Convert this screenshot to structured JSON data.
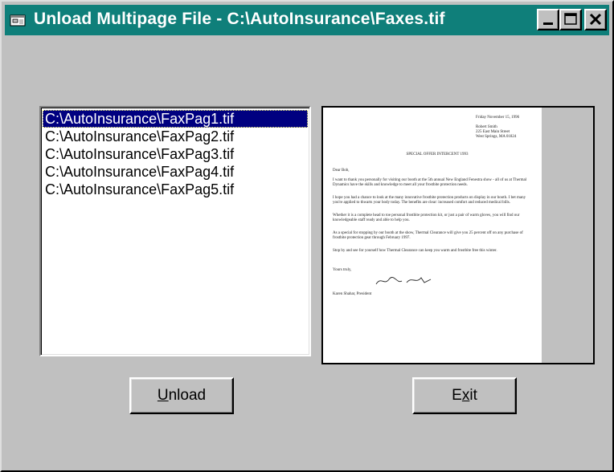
{
  "window": {
    "title": "Unload Multipage File - C:\\AutoInsurance\\Faxes.tif"
  },
  "list": {
    "items": [
      "C:\\AutoInsurance\\FaxPag1.tif",
      "C:\\AutoInsurance\\FaxPag2.tif",
      "C:\\AutoInsurance\\FaxPag3.tif",
      "C:\\AutoInsurance\\FaxPag4.tif",
      "C:\\AutoInsurance\\FaxPag5.tif"
    ],
    "selected_index": 0
  },
  "preview": {
    "date": "Friday November 15, 1996",
    "address": [
      "Robert Smith",
      "225 East Main Street",
      "West Springs, MA 01824"
    ],
    "subject": "SPECIAL OFFER INTERCENT 1993",
    "salutation": "Dear Bob,",
    "paragraphs": [
      "I want to thank you personally for visiting our booth at the 5th annual New England Fenestra show - all of us at Thermal Dynamics have the skills and knowledge to meet all your frostbite protection needs.",
      "I hope you had a chance to look at the many innovative frostbite protection products on display in our booth. I bet many you're applied to thwarts your body today. The benefits are clear: increased comfort and reduced medical bills.",
      "Whether it is a complete head to toe personal frostbite protection kit, or just a pair of warm gloves, you will find our knowledgeable staff ready and able to help you.",
      "As a special for stopping by our booth at the show, Thermal Clearance will give you 25 percent off on any purchase of frostbite protection gear through February 1997.",
      "Stop by and see for yourself how Thermal Clearance can keep you warm and frostbite free this winter."
    ],
    "closing": "Yours truly,",
    "signer": "Karen Shahar, President"
  },
  "buttons": {
    "unload_mnemonic": "U",
    "unload_rest": "nload",
    "exit_start": "E",
    "exit_mnemonic": "x",
    "exit_rest": "it"
  },
  "colors": {
    "titlebar": "#0f7f7a",
    "face": "#c0c0c0",
    "selection": "#000080"
  }
}
